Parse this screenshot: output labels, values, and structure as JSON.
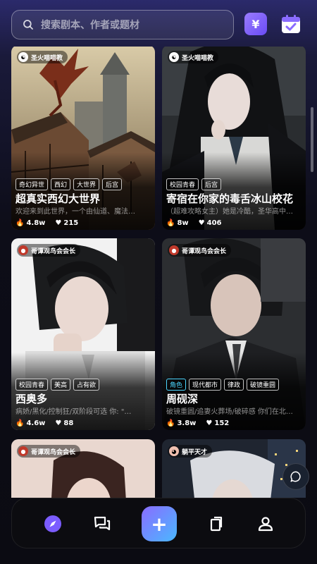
{
  "search": {
    "placeholder": "搜索剧本、作者或题材"
  },
  "header": {
    "coin_icon": "yen-coin-icon",
    "yen_symbol": "¥",
    "checkin_icon": "calendar-check-icon"
  },
  "cards": [
    {
      "author": "圣火喵喵教",
      "tags": [
        "奇幻异世",
        "西幻",
        "大世界",
        "后宫"
      ],
      "title": "超真实西幻大世界",
      "desc": "欢迎来到此世界，一个由仙道、魔法…",
      "views": "4.8w",
      "likes": "215"
    },
    {
      "author": "圣火喵喵教",
      "tags": [
        "校园青春",
        "后宫"
      ],
      "title": "寄宿在你家的毒舌冰山校花",
      "desc": "（超难攻略女主）她是冷酷，圣华高中…",
      "views": "8w",
      "likes": "406"
    },
    {
      "author": "哥谭观鸟会会长",
      "tags": [
        "校园青春",
        "美高",
        "占有欲"
      ],
      "title": "西奥多",
      "desc": "病娇/黑化/控制狂/双阶段可选 你: \"…",
      "views": "4.6w",
      "likes": "88"
    },
    {
      "author": "哥谭观鸟会会长",
      "tags": [
        "角色",
        "现代都市",
        "律政",
        "破镜重圆"
      ],
      "title": "周砚深",
      "desc": "破镜重圆/追妻火葬场/破碎感 你们在北…",
      "views": "3.8w",
      "likes": "152"
    },
    {
      "author": "哥谭观鸟会会长"
    },
    {
      "author": "躺平天才"
    }
  ],
  "colors": {
    "accent": "#7b5cff",
    "tag_highlight": "#4cd6ff"
  },
  "nav": {
    "items": [
      "discover-icon",
      "chat-icon",
      "plus-icon",
      "library-icon",
      "profile-icon"
    ],
    "plus_symbol": "+"
  }
}
